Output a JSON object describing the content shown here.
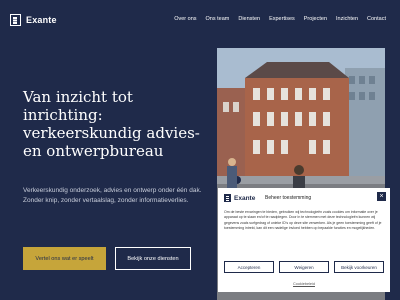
{
  "header": {
    "logo_text": "Exante",
    "nav": [
      "Over ons",
      "Ons team",
      "Diensten",
      "Expertises",
      "Projecten",
      "Inzichten",
      "Contact"
    ]
  },
  "hero": {
    "title": "Van inzicht tot inrichting: verkeerskundig advies- en ontwerpbureau",
    "subtitle": "Verkeerskundig onderzoek, advies en ontwerp onder één dak. Zonder knip, zonder vertaalslag, zonder informatieverlies.",
    "primary_button": "Vertel ons wat er speelt",
    "secondary_button": "Bekijk onze diensten"
  },
  "cookie": {
    "logo_text": "Exante",
    "title": "Beheer toestemming",
    "close_symbol": "×",
    "text": "Om de beste ervaringen te bieden, gebruiken wij technologieën zoals cookies om informatie over je apparaat op te slaan en/of te raadplegen. Door in te stemmen met deze technologieën kunnen wij gegevens zoals surfgedrag of unieke ID's op deze site verwerken. Als je geen toestemming geeft of je toestemming intrekt, kan dit een nadelige invloed hebben op bepaalde functies en mogelijkheden.",
    "accept_label": "Accepteren",
    "deny_label": "Weigeren",
    "prefs_label": "Bekijk voorkeuren",
    "policy_link": "Cookiebeleid"
  },
  "colors": {
    "background": "#1f2a4a",
    "accent": "#c6a53a"
  }
}
